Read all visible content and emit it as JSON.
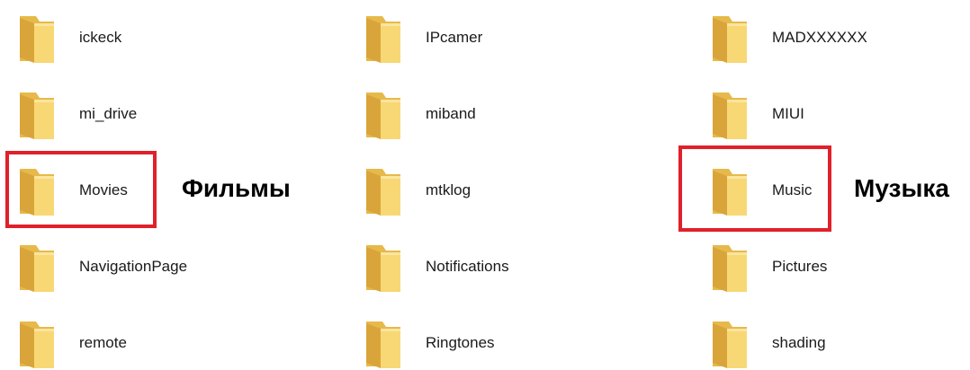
{
  "folders": {
    "col1": [
      {
        "label": "ickeck"
      },
      {
        "label": "mi_drive"
      },
      {
        "label": "Movies"
      },
      {
        "label": "NavigationPage"
      },
      {
        "label": "remote"
      }
    ],
    "col2": [
      {
        "label": "IPcamer"
      },
      {
        "label": "miband"
      },
      {
        "label": "mtklog"
      },
      {
        "label": "Notifications"
      },
      {
        "label": "Ringtones"
      }
    ],
    "col3": [
      {
        "label": "MADXXXXXX"
      },
      {
        "label": "MIUI"
      },
      {
        "label": "Music"
      },
      {
        "label": "Pictures"
      },
      {
        "label": "shading"
      }
    ]
  },
  "annotations": {
    "movies": "Фильмы",
    "music": "Музыка"
  },
  "colors": {
    "highlight": "#e0202a",
    "folder_front": "#f8d775",
    "folder_back": "#e6b94a"
  },
  "icons": {
    "folder": "folder-icon"
  }
}
